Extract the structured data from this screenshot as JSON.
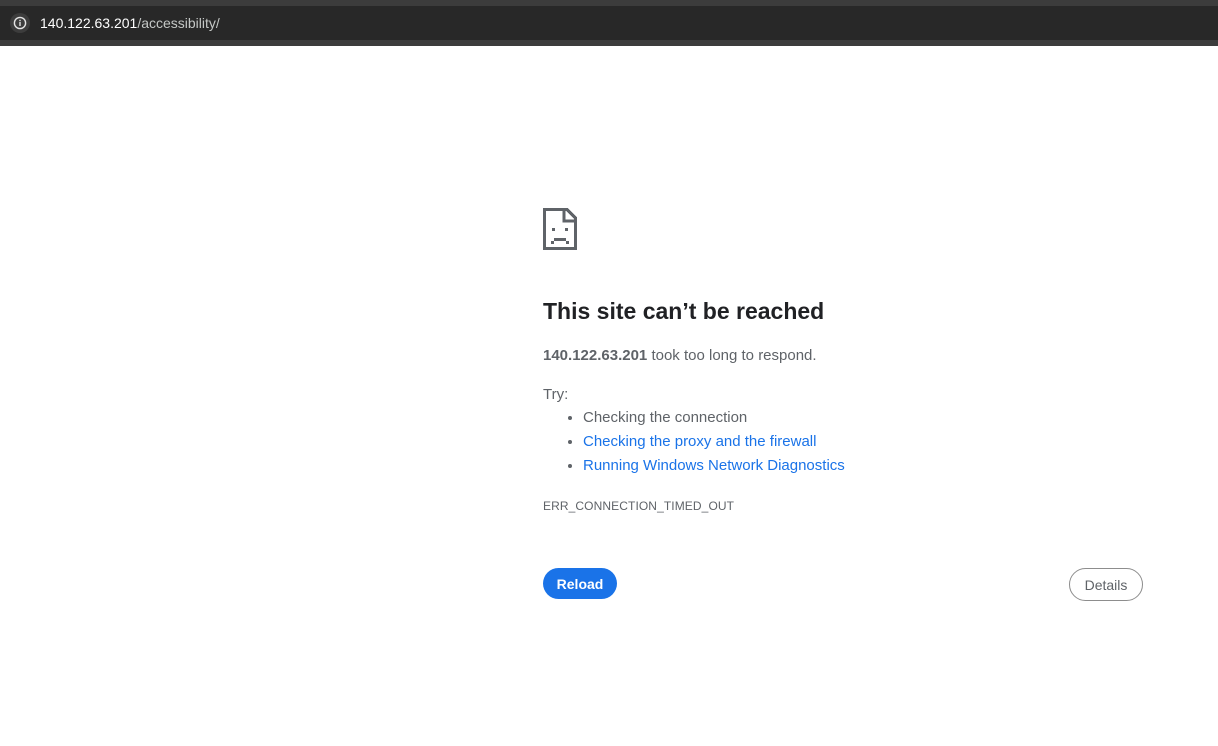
{
  "address_bar": {
    "url_host": "140.122.63.201",
    "url_path": "/accessibility/",
    "site_info_icon": "info-circle-icon"
  },
  "error_page": {
    "icon": "sad-page-icon",
    "heading": "This site can’t be reached",
    "host": "140.122.63.201",
    "message_suffix": " took too long to respond.",
    "try_label": "Try:",
    "suggestions": [
      {
        "label": "Checking the connection",
        "is_link": false
      },
      {
        "label": "Checking the proxy and the firewall",
        "is_link": true
      },
      {
        "label": "Running Windows Network Diagnostics",
        "is_link": true
      }
    ],
    "error_code": "ERR_CONNECTION_TIMED_OUT",
    "reload_label": "Reload",
    "details_label": "Details"
  },
  "colors": {
    "accent": "#1a73e8",
    "heading": "#202124",
    "body_text": "#5f6368",
    "address_bar_bg": "#282828"
  }
}
